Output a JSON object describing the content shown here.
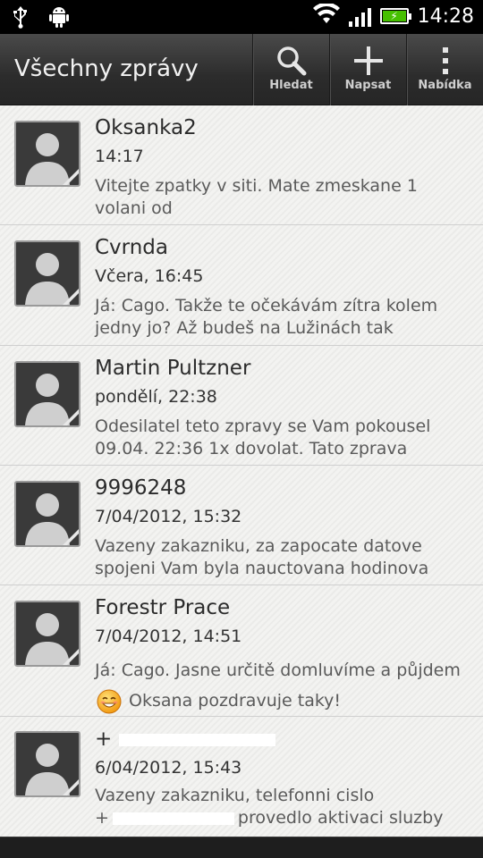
{
  "status_bar": {
    "time": "14:28",
    "icons": [
      "usb-icon",
      "android-debug-icon",
      "wifi-icon",
      "signal-icon",
      "battery-charging-icon"
    ]
  },
  "action_bar": {
    "title": "Všechny zprávy",
    "actions": [
      {
        "label": "Hledat",
        "icon": "search-icon"
      },
      {
        "label": "Napsat",
        "icon": "plus-icon"
      },
      {
        "label": "Nabídka",
        "icon": "menu-dots-icon"
      }
    ]
  },
  "conversations": [
    {
      "name": "Oksanka2",
      "time": "14:17",
      "message": "Vitejte zpatky v siti. Mate zmeskane 1 volani od"
    },
    {
      "name": "Cvrnda",
      "time": "Včera, 16:45",
      "message": "Já: Cago. Takže te očekávám zítra kolem jedny jo? Až budeš na Lužinách tak"
    },
    {
      "name": "Martin Pultzner",
      "time": "pondělí, 22:38",
      "message": "Odesilatel teto zpravy se Vam pokousel 09.04. 22:36 1x dovolat. Tato zprava"
    },
    {
      "name": "9996248",
      "time": "7/04/2012, 15:32",
      "message": "Vazeny zakazniku, za zapocate datove spojeni Vam byla nauctovana hodinova"
    },
    {
      "name": "Forestr Prace",
      "time": "7/04/2012, 14:51",
      "message_part1": "Já: Cago. Jasne určitě domluvíme a půjdem",
      "message_part2": "Oksana pozdravuje taky!",
      "emoji": "smiley-emoji"
    },
    {
      "name": "+",
      "time": "6/04/2012, 15:43",
      "message_part1": "Vazeny zakazniku, telefonni cislo",
      "message_part2": "+",
      "message_part3": "provedlo aktivaci sluzby"
    }
  ]
}
